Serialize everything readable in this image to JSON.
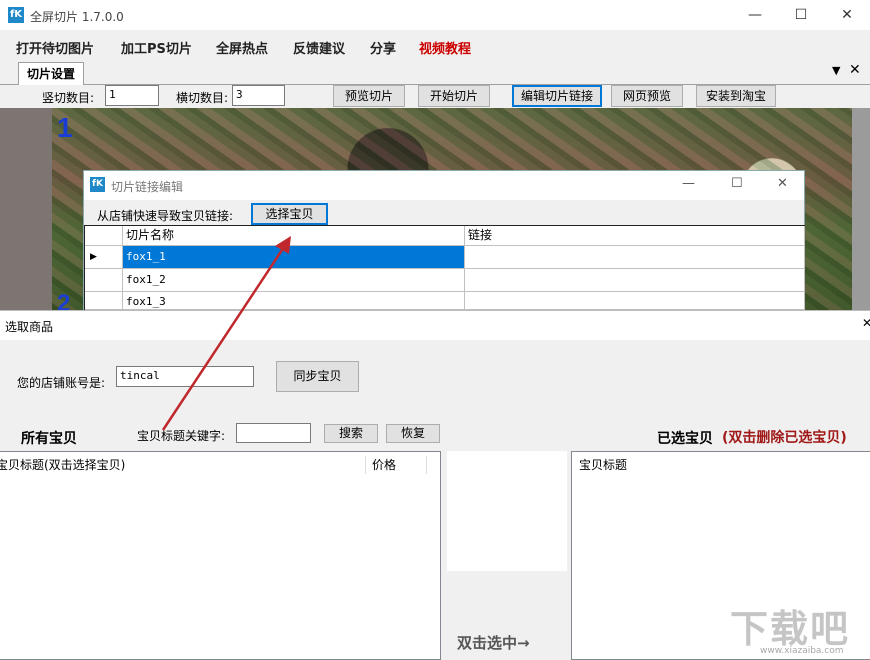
{
  "app": {
    "title": "全屏切片 1.7.0.0",
    "logo": "fK"
  },
  "menu": [
    "打开待切图片",
    "加工PS切片",
    "全屏热点",
    "反馈建议",
    "分享",
    "视频教程"
  ],
  "menu_highlight_color": "#cc0000",
  "tab": {
    "label": "切片设置"
  },
  "toolbar": {
    "vertical_label": "竖切数目:",
    "vertical_value": "1",
    "horizontal_label": "横切数目:",
    "horizontal_value": "3",
    "preview_slice": "预览切片",
    "start_slice": "开始切片",
    "edit_links": "编辑切片链接",
    "web_preview": "网页预览",
    "install_taobao": "安装到淘宝"
  },
  "canvas": {
    "marker_1": "1",
    "marker_2": "2"
  },
  "link_dialog": {
    "logo": "fK",
    "title": "切片链接编辑",
    "shop_label": "从店铺快速导致宝贝链接:",
    "select_button": "选择宝贝",
    "columns": [
      "切片名称",
      "链接"
    ],
    "rows": [
      {
        "name": "fox1_1",
        "link": ""
      },
      {
        "name": "fox1_2",
        "link": ""
      },
      {
        "name": "fox1_3",
        "link": ""
      }
    ]
  },
  "select_dialog": {
    "title": "选取商品",
    "account_label": "您的店铺账号是:",
    "account_value": "tincal",
    "sync_button": "同步宝贝",
    "all_items_label": "所有宝贝",
    "keyword_label": "宝贝标题关键字:",
    "keyword_value": "",
    "search_button": "搜索",
    "restore_button": "恢复",
    "selected_label": "已选宝贝",
    "selected_hint": "(双击删除已选宝贝)",
    "left_columns": [
      "宝贝标题(双击选择宝贝)",
      "价格"
    ],
    "right_column": "宝贝标题",
    "double_click_hint": "双击选中→"
  },
  "watermark": {
    "text": "下载吧",
    "url": "www.xiazaiba.com"
  }
}
